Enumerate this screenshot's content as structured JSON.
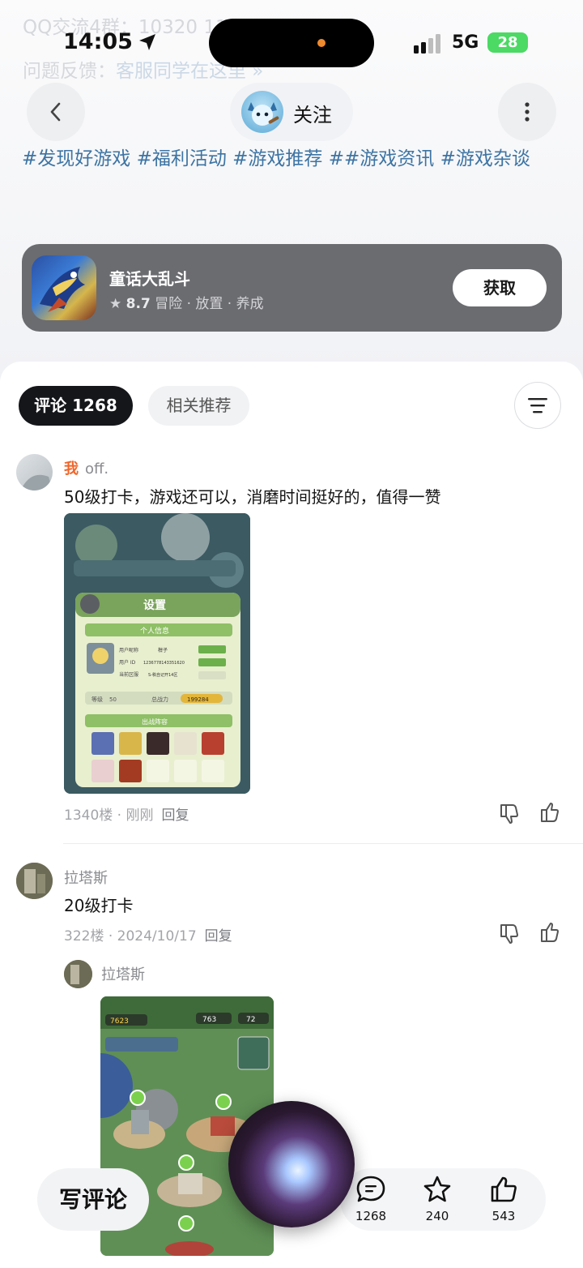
{
  "background_text": {
    "qq_group": "QQ交流4群：10320 11250",
    "feedback_label": "问题反馈：",
    "feedback_link": "客服同学在这里 »"
  },
  "status_bar": {
    "time": "14:05",
    "network": "5G",
    "battery": "28"
  },
  "header": {
    "follow_label": "关注"
  },
  "tags": "#发现好游戏 #福利活动 #游戏推荐 ##游戏资讯 #游戏杂谈",
  "app_card": {
    "name": "童话大乱斗",
    "rating": "8.7",
    "genres": "冒险 · 放置 · 养成",
    "get_label": "获取"
  },
  "tabs": {
    "comments": "评论 1268",
    "related": "相关推荐"
  },
  "comments": [
    {
      "me_badge": "我",
      "author": "off.",
      "text": "50级打卡，游戏还可以，消磨时间挺好的，值得一赞",
      "floor": "1340楼 · 刚刚",
      "reply_label": "回复"
    },
    {
      "author": "拉塔斯",
      "text": "20级打卡",
      "floor": "322楼 · 2024/10/17",
      "reply_label": "回复",
      "nested_author": "拉塔斯"
    }
  ],
  "screenshot1": {
    "title": "设置",
    "section": "个人信息",
    "nickname_label": "用户昵称",
    "nickname_value": "柑子",
    "uid_label": "用户 ID",
    "uid_value": "1236778143351620",
    "server_label": "当前区服",
    "server_value": "S-秩自记开14区",
    "level_label": "等级",
    "level_value": "50",
    "power_label": "总战力",
    "power_value": "199284",
    "lineup_label": "出战阵容"
  },
  "screenshot2": {
    "gold": "7623",
    "gem": "763",
    "energy": "72"
  },
  "bottom_bar": {
    "write_label": "写评论",
    "comment_count": "1268",
    "fav_count": "240",
    "like_count": "543"
  }
}
